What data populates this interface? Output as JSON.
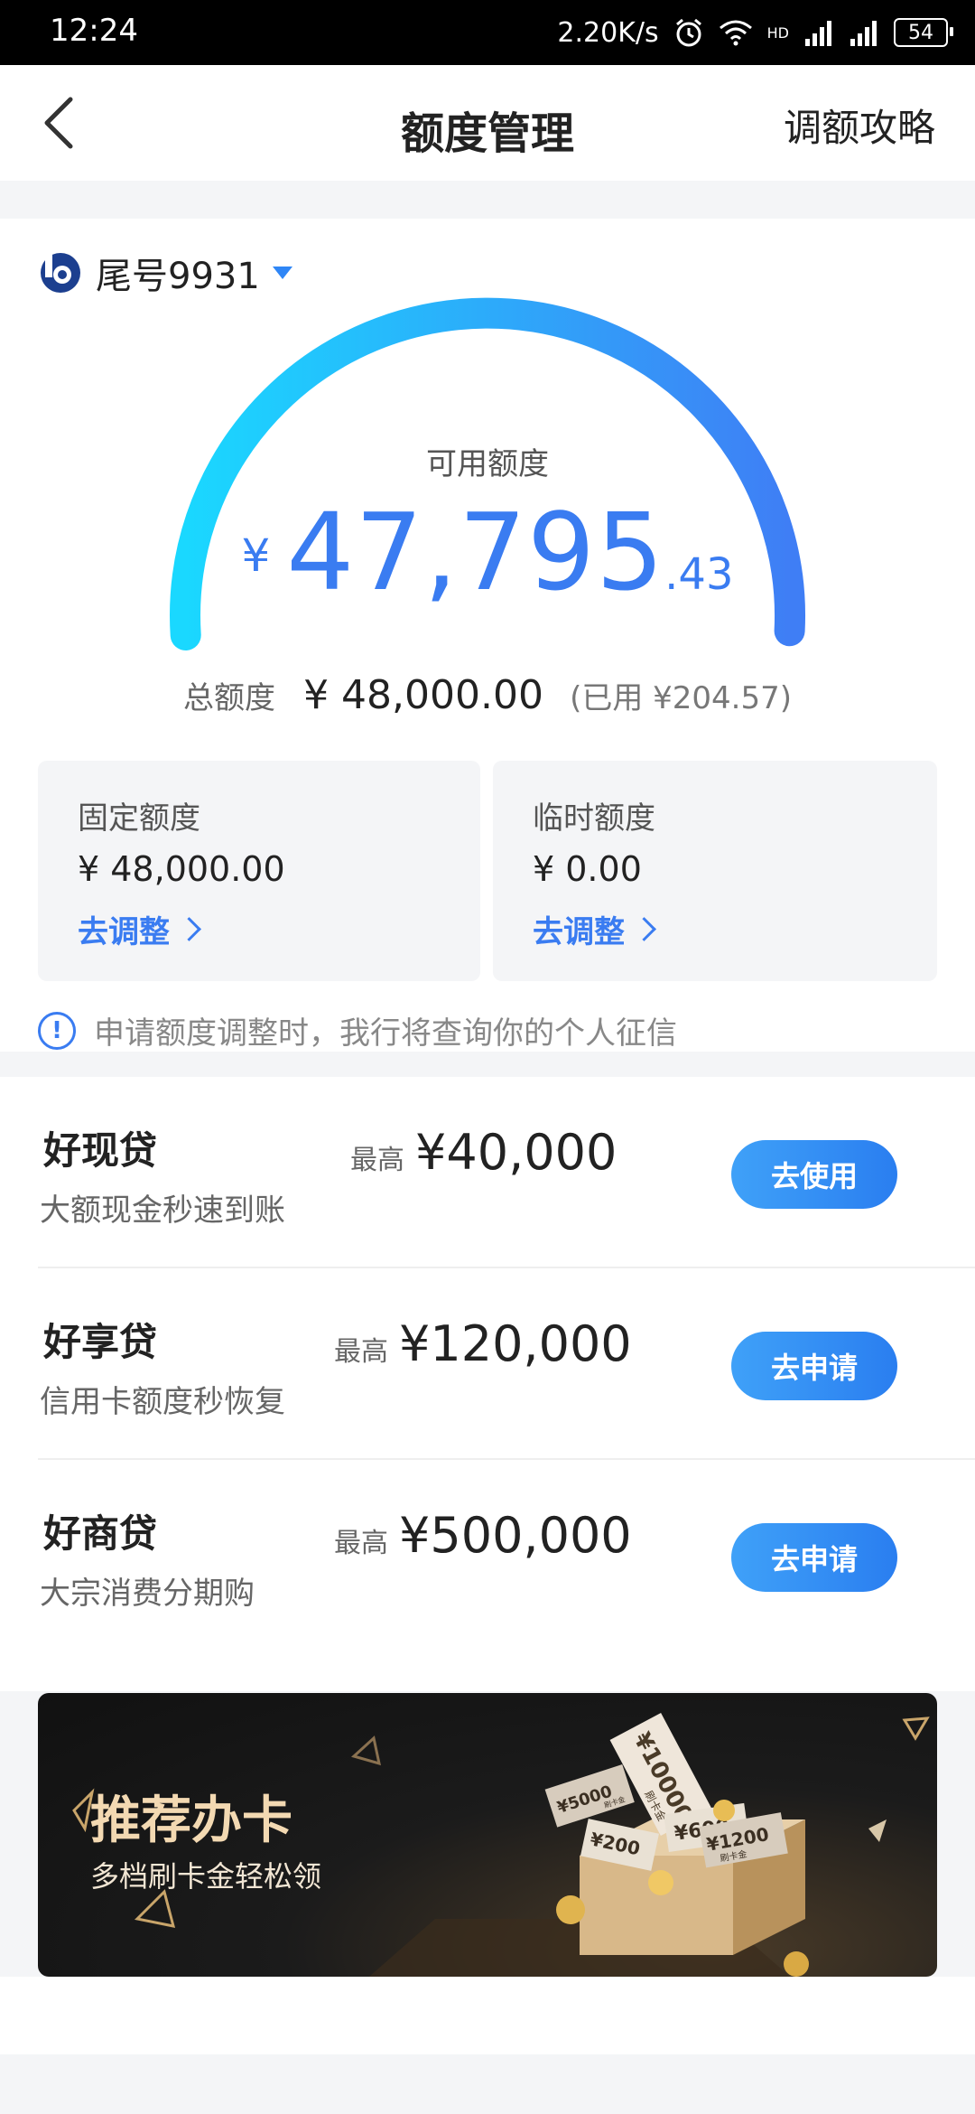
{
  "status_bar": {
    "time": "12:24",
    "speed": "2.20K/s",
    "network_1": "HD",
    "network_2": "4G",
    "network_3": "4G",
    "battery": "54"
  },
  "nav": {
    "title": "额度管理",
    "right_action": "调额攻略"
  },
  "account": {
    "label": "尾号9931"
  },
  "available": {
    "label": "可用额度",
    "currency": "¥",
    "integer": "47,795",
    "decimal": ".43"
  },
  "total": {
    "label": "总额度",
    "amount": "¥ 48,000.00",
    "used": "(已用 ¥204.57)"
  },
  "fixed": {
    "title": "固定额度",
    "value": "¥ 48,000.00",
    "link": "去调整"
  },
  "temporary": {
    "title": "临时额度",
    "value": "¥ 0.00",
    "link": "去调整"
  },
  "notice": {
    "text": "申请额度调整时，我行将查询你的个人征信"
  },
  "loans": [
    {
      "name": "好现贷",
      "desc": "大额现金秒速到账",
      "max_label": "最高",
      "max_amount": "¥40,000",
      "button": "去使用"
    },
    {
      "name": "好享贷",
      "desc": "信用卡额度秒恢复",
      "max_label": "最高",
      "max_amount": "¥120,000",
      "button": "去申请"
    },
    {
      "name": "好商贷",
      "desc": "大宗消费分期购",
      "max_label": "最高",
      "max_amount": "¥500,000",
      "button": "去申请"
    }
  ],
  "banner": {
    "title": "推荐办卡",
    "subtitle": "多档刷卡金轻松领",
    "tickets": [
      "¥10000",
      "¥5000",
      "¥600",
      "¥200",
      "¥1200"
    ],
    "ticket_caption": "刷卡金"
  },
  "colors": {
    "accent": "#3a7cf1",
    "gauge_start": "#1ad8ff",
    "gauge_end": "#3f7ef5"
  },
  "available_ratio": 0.9957
}
